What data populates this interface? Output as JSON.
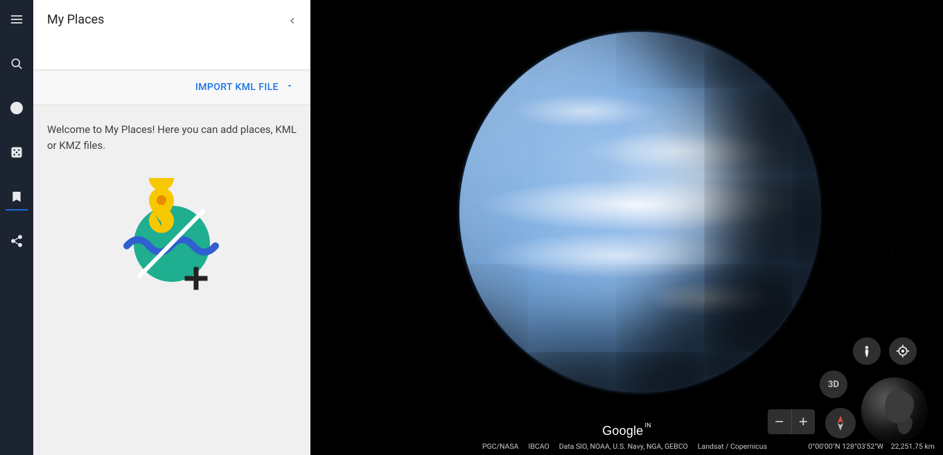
{
  "panel": {
    "title": "My Places",
    "import_label": "IMPORT KML FILE",
    "welcome_text": "Welcome to My Places! Here you can add places, KML or KMZ files."
  },
  "toolbar": {
    "items": [
      {
        "name": "menu-icon"
      },
      {
        "name": "search-icon"
      },
      {
        "name": "voyager-icon"
      },
      {
        "name": "lucky-icon"
      },
      {
        "name": "places-icon",
        "active": true
      },
      {
        "name": "share-icon"
      }
    ]
  },
  "controls": {
    "view3d_label": "3D",
    "zoom_out": "−",
    "zoom_in": "+"
  },
  "footer": {
    "logo": "Google",
    "logo_locale": "IN",
    "attrib_pgc": "PGC/NASA",
    "attrib_ibcao": "IBCAO",
    "attrib_data": "Data SIO, NOAA, U.S. Navy, NGA, GEBCO",
    "attrib_landsat": "Landsat / Copernicus",
    "coords": "0°00'00\"N 128°03'52\"W",
    "camera_alt": "22,251.75 km"
  }
}
